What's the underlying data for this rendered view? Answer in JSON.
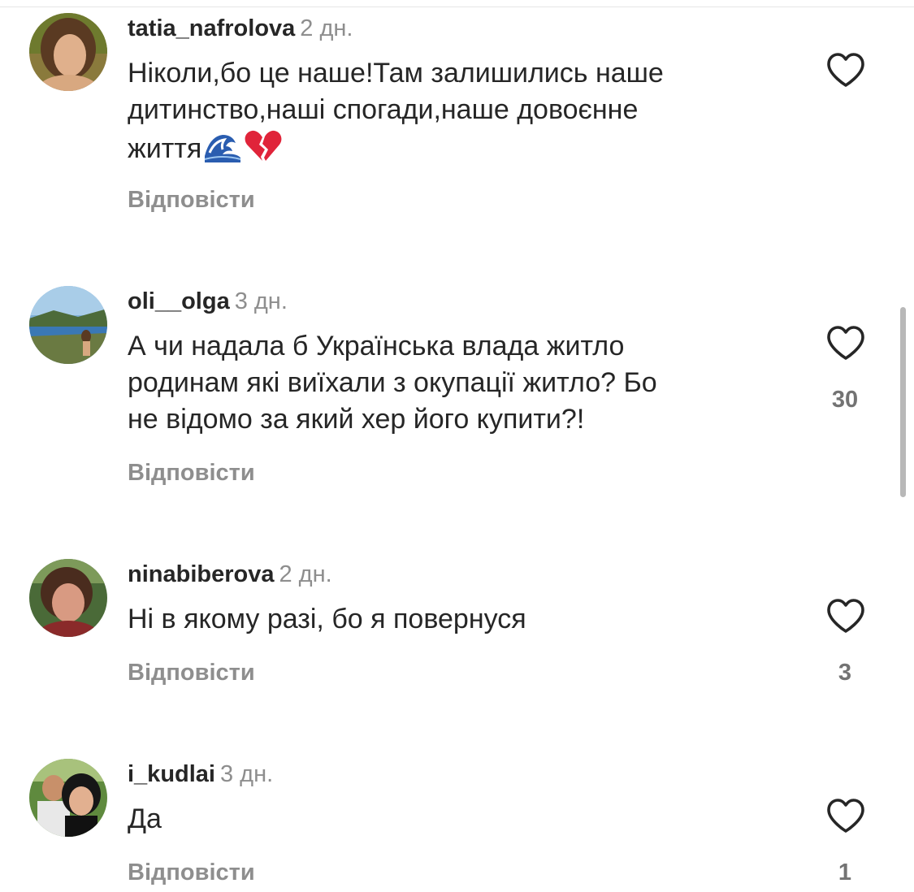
{
  "comments": [
    {
      "username": "tatia_nafrolova",
      "time": "2 дн.",
      "text_lines": [
        "Ніколи,бо це наше!Там залишились наше",
        "дитинство,наші спогади,наше довоєнне",
        "життя"
      ],
      "emojis": [
        "wave-emoji",
        "broken-heart-emoji"
      ],
      "reply_label": "Відповісти",
      "like_count": ""
    },
    {
      "username": "oli__olga",
      "time": "3 дн.",
      "text_lines": [
        "А чи надала б Українська влада житло",
        "родинам які виїхали з окупації житло? Бо",
        "не відомо за який хер його купити?!"
      ],
      "reply_label": "Відповісти",
      "like_count": "30"
    },
    {
      "username": "ninabiberova",
      "time": "2 дн.",
      "text_lines": [
        "Ні в якому разі, бо я повернуся"
      ],
      "reply_label": "Відповісти",
      "like_count": "3"
    },
    {
      "username": "i_kudlai",
      "time": "3 дн.",
      "text_lines": [
        "Да"
      ],
      "reply_label": "Відповісти",
      "like_count": "1"
    }
  ],
  "icons": {
    "like": "heart-outline-icon"
  },
  "colors": {
    "username": "#262626",
    "muted": "#8e8e8e",
    "like_count": "#737373",
    "icon": "#262626",
    "broken_heart": "#e0243a"
  }
}
